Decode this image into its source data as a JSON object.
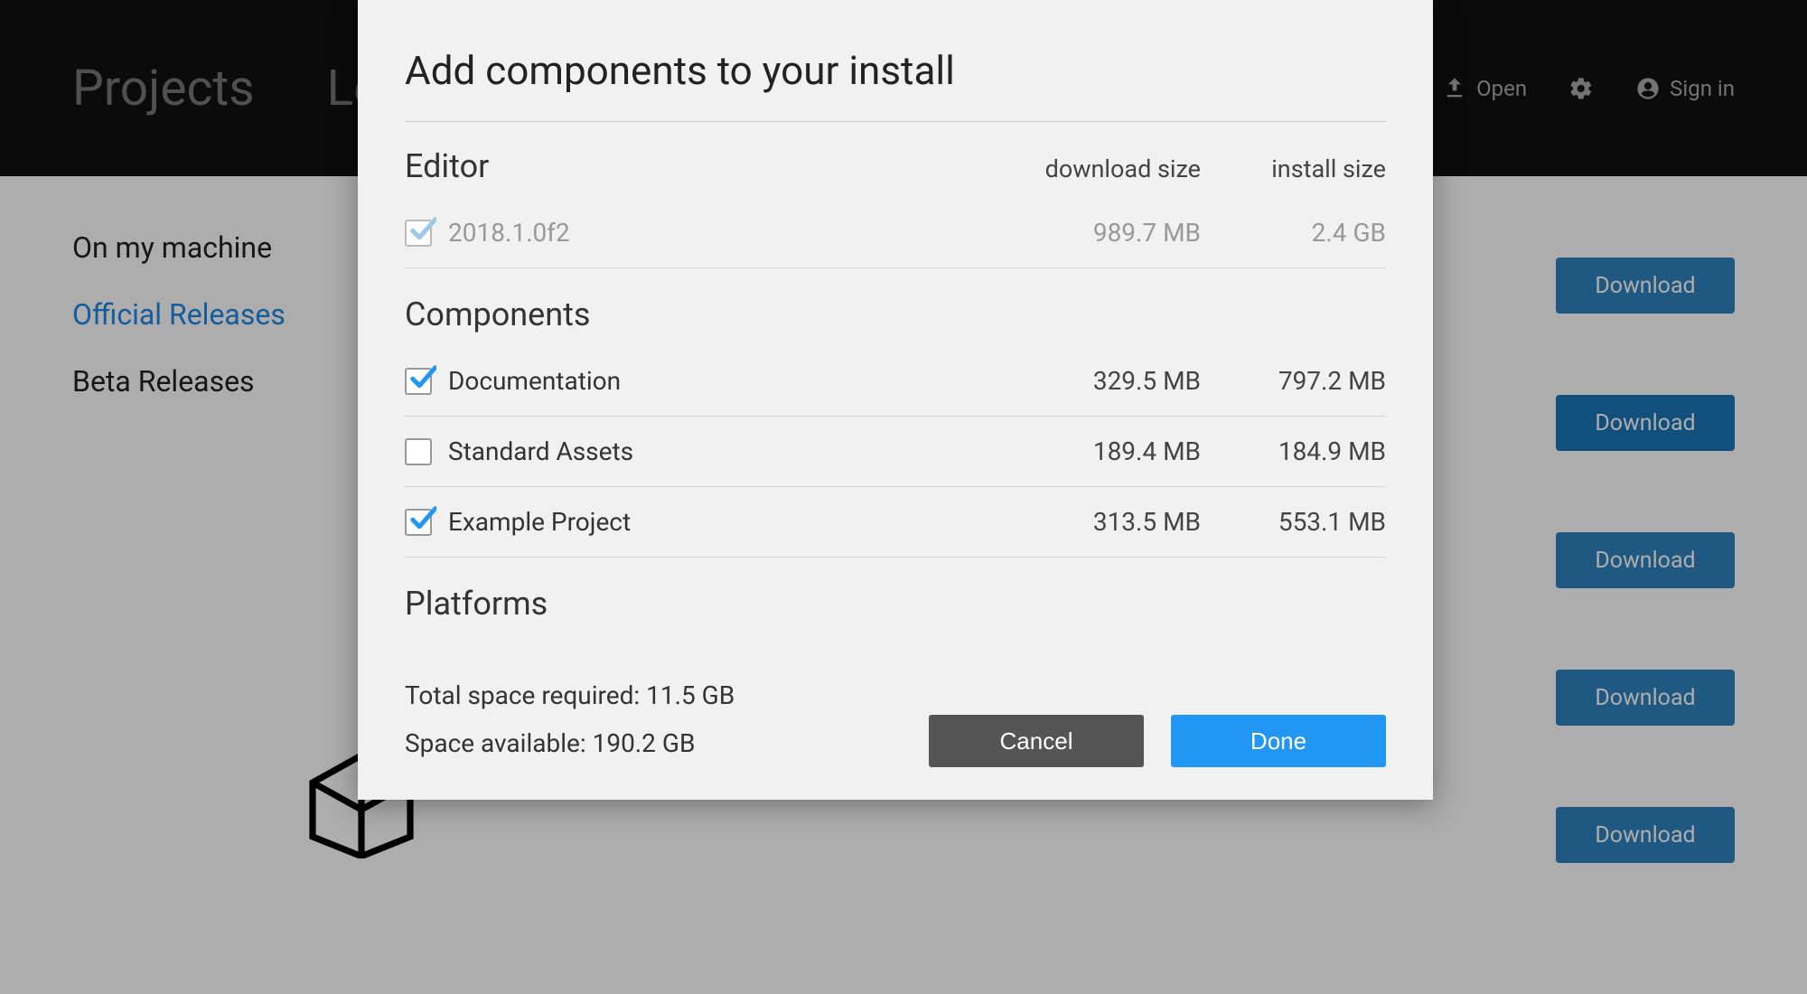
{
  "header": {
    "nav": {
      "projects": "Projects",
      "learn": "Lea"
    },
    "open": "Open",
    "signin": "Sign in"
  },
  "sidebar": {
    "onMachine": "On my machine",
    "official": "Official Releases",
    "beta": "Beta Releases"
  },
  "downloads": {
    "label": "Download"
  },
  "modal": {
    "title": "Add components to your install",
    "cols": {
      "download": "download size",
      "install": "install size"
    },
    "editor": {
      "title": "Editor",
      "items": [
        {
          "name": "2018.1.0f2",
          "dl": "989.7 MB",
          "in": "2.4 GB",
          "checked": true,
          "locked": true
        }
      ]
    },
    "components": {
      "title": "Components",
      "items": [
        {
          "name": "Documentation",
          "dl": "329.5 MB",
          "in": "797.2 MB",
          "checked": true
        },
        {
          "name": "Standard Assets",
          "dl": "189.4 MB",
          "in": "184.9 MB",
          "checked": false
        },
        {
          "name": "Example Project",
          "dl": "313.5 MB",
          "in": "553.1 MB",
          "checked": true
        }
      ]
    },
    "platforms": {
      "title": "Platforms"
    },
    "footer": {
      "required": "Total space required: 11.5 GB",
      "available": "Space available: 190.2 GB",
      "cancel": "Cancel",
      "done": "Done"
    }
  }
}
